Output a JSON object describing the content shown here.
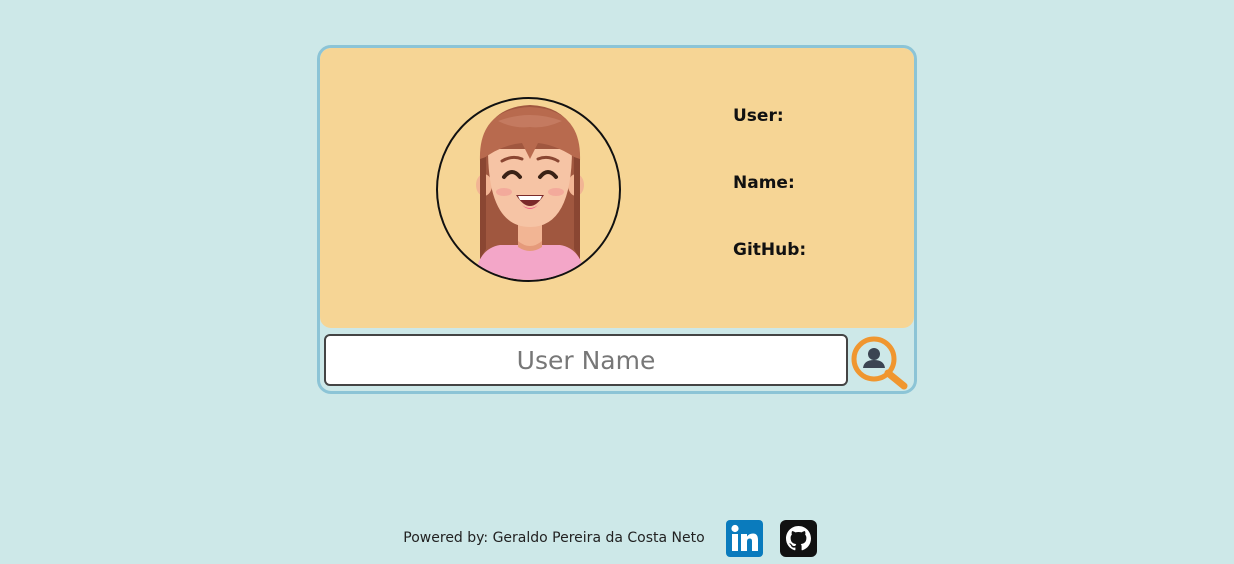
{
  "profile": {
    "user_label": "User:",
    "name_label": "Name:",
    "github_label": "GitHub:"
  },
  "search": {
    "placeholder": "User Name",
    "value": ""
  },
  "footer": {
    "powered_by": "Powered by: Geraldo Pereira da Costa Neto"
  },
  "icons": {
    "avatar": "cartoon-woman-avatar",
    "search_button": "user-search-magnifier-icon",
    "linkedin": "linkedin-icon",
    "github": "github-icon"
  },
  "colors": {
    "background": "#cde8e8",
    "card_top": "#f6d595",
    "card_border": "#8cc4d6",
    "search_accent": "#f0962f",
    "linkedin": "#0a7bbd"
  }
}
